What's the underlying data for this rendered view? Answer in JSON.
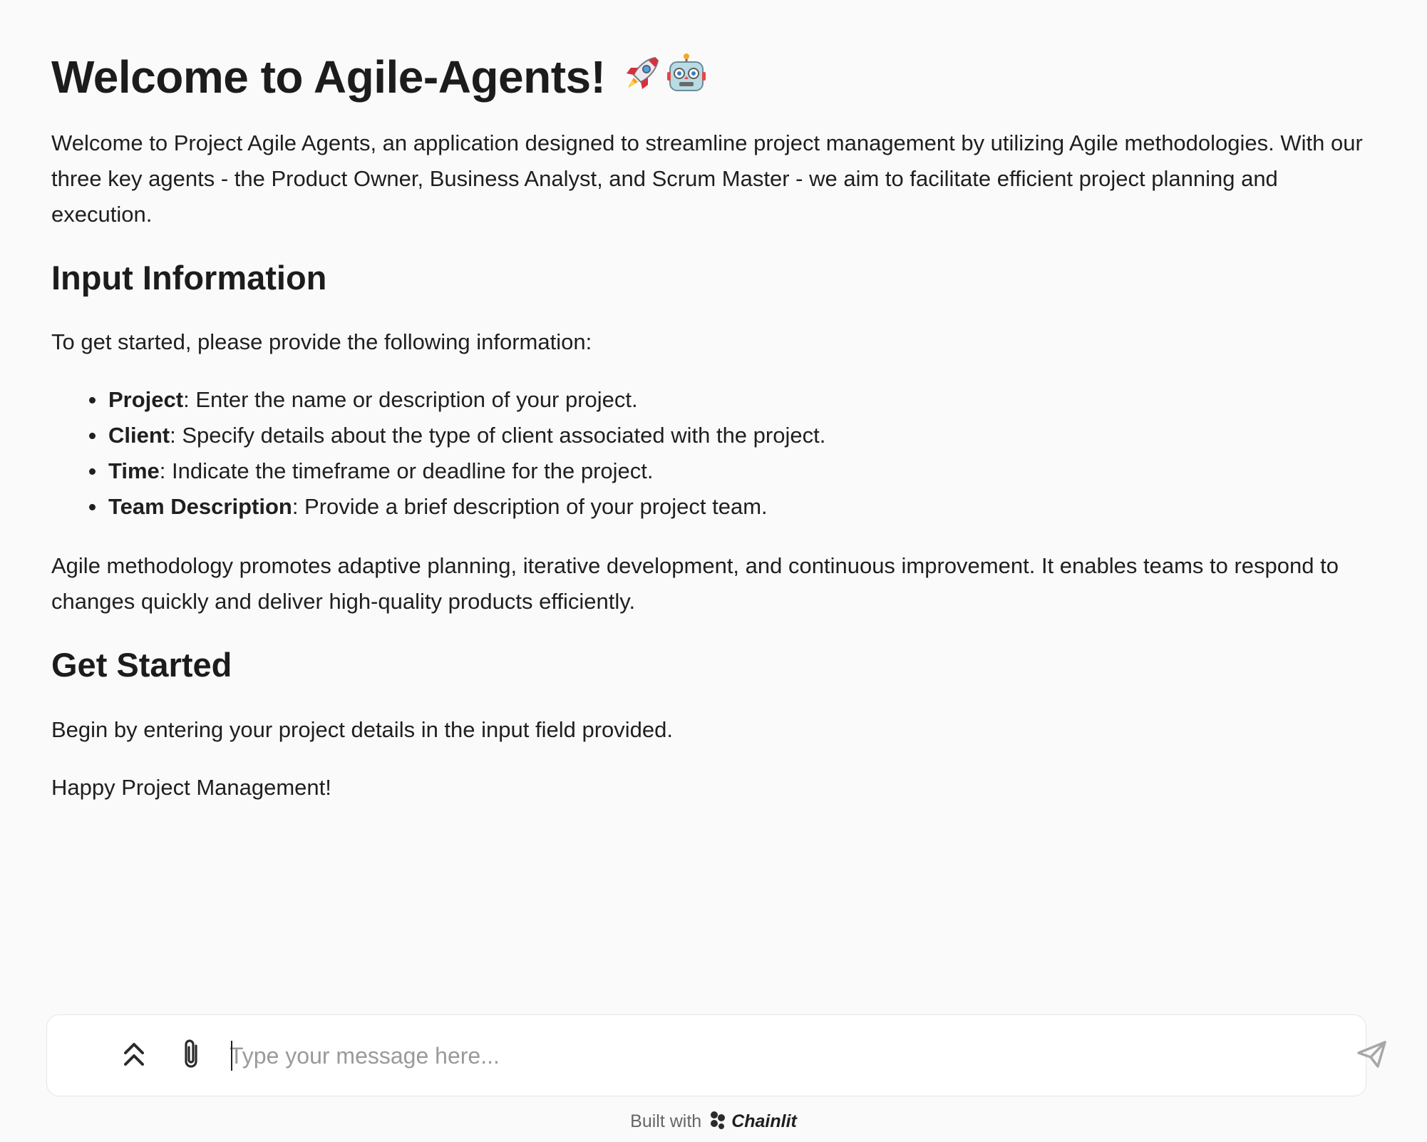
{
  "welcome": {
    "title": "Welcome to Agile-Agents!",
    "title_icons": [
      "rocket-icon",
      "robot-icon"
    ],
    "intro": "Welcome to Project Agile Agents, an application designed to streamline project management by utilizing Agile methodologies. With our three key agents - the Product Owner, Business Analyst, and Scrum Master - we aim to facilitate efficient project planning and execution."
  },
  "input_section": {
    "heading": "Input Information",
    "lead": "To get started, please provide the following information:",
    "fields": [
      {
        "term": "Project",
        "desc": ": Enter the name or description of your project."
      },
      {
        "term": "Client",
        "desc": ": Specify details about the type of client associated with the project."
      },
      {
        "term": "Time",
        "desc": ": Indicate the timeframe or deadline for the project."
      },
      {
        "term": "Team Description",
        "desc": ": Provide a brief description of your project team."
      }
    ],
    "agile_note": "Agile methodology promotes adaptive planning, iterative development, and continuous improvement. It enables teams to respond to changes quickly and deliver high-quality products efficiently."
  },
  "get_started": {
    "heading": "Get Started",
    "instruction": "Begin by entering your project details in the input field provided.",
    "closing": "Happy Project Management!"
  },
  "composer": {
    "placeholder": "Type your message here...",
    "value": "",
    "icons": [
      "chevrons-up-icon",
      "paperclip-icon",
      "send-icon"
    ]
  },
  "footer": {
    "prefix": "Built with",
    "brand": "Chainlit"
  }
}
